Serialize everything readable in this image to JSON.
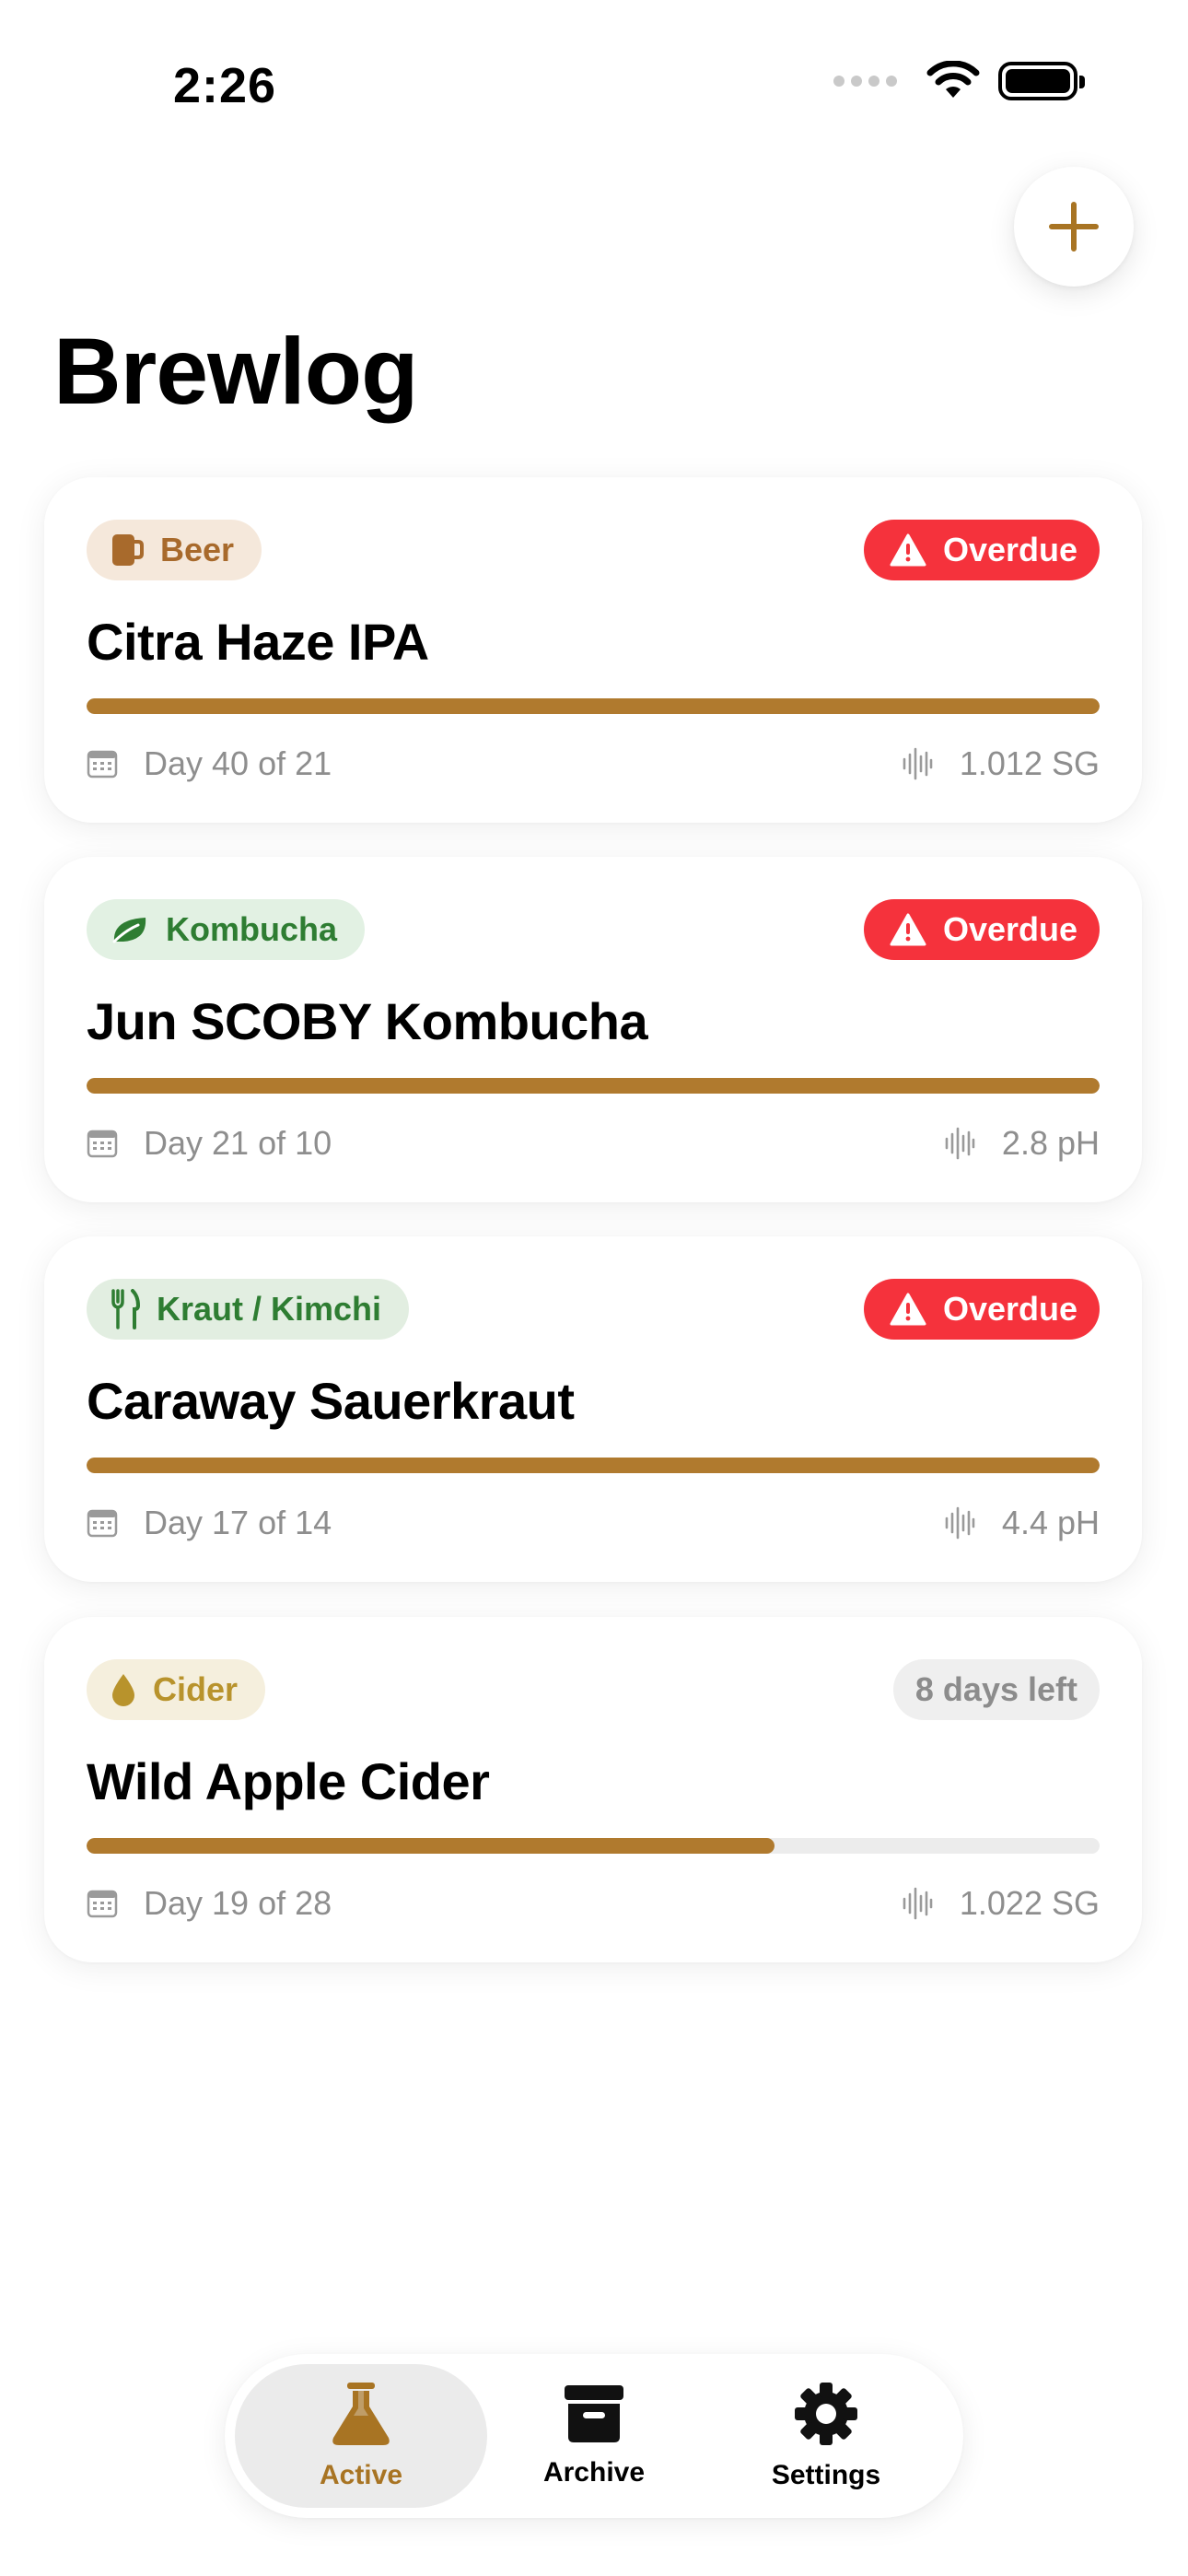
{
  "status_bar": {
    "time": "2:26"
  },
  "header": {
    "title": "Brewlog"
  },
  "brews": [
    {
      "category": "Beer",
      "category_icon": "mug-icon",
      "category_color": "#a86a2c",
      "category_bg": "#f5e8db",
      "name": "Citra Haze IPA",
      "status": "Overdue",
      "status_type": "overdue",
      "progress": 1.0,
      "day_text": "Day 40 of 21",
      "reading": "1.012 SG"
    },
    {
      "category": "Kombucha",
      "category_icon": "leaf-icon",
      "category_color": "#2e7d32",
      "category_bg": "#e2f1e3",
      "name": "Jun SCOBY Kombucha",
      "status": "Overdue",
      "status_type": "overdue",
      "progress": 1.0,
      "day_text": "Day 21 of 10",
      "reading": "2.8 pH"
    },
    {
      "category": "Kraut / Kimchi",
      "category_icon": "fork-knife-icon",
      "category_color": "#2e7d32",
      "category_bg": "#e2eee1",
      "name": "Caraway Sauerkraut",
      "status": "Overdue",
      "status_type": "overdue",
      "progress": 1.0,
      "day_text": "Day 17 of 14",
      "reading": "4.4 pH"
    },
    {
      "category": "Cider",
      "category_icon": "drop-icon",
      "category_color": "#b8932c",
      "category_bg": "#f5efdd",
      "name": "Wild Apple Cider",
      "status": "8 days left",
      "status_type": "neutral",
      "progress": 0.679,
      "day_text": "Day 19 of 28",
      "reading": "1.022 SG"
    }
  ],
  "tabs": [
    {
      "label": "Active",
      "icon": "flask-icon",
      "active": true
    },
    {
      "label": "Archive",
      "icon": "archive-box-icon",
      "active": false
    },
    {
      "label": "Settings",
      "icon": "gear-icon",
      "active": false
    }
  ],
  "colors": {
    "accent": "#b07a2e",
    "overdue": "#f5323c"
  }
}
